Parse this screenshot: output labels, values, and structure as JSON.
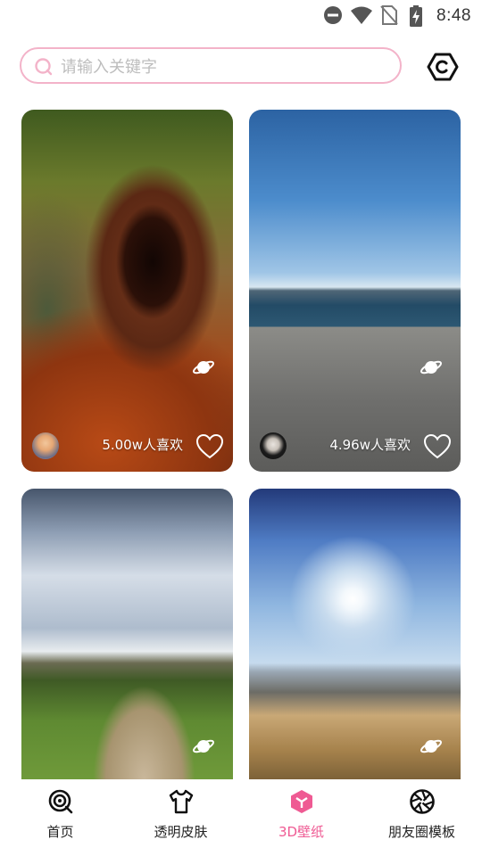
{
  "status_bar": {
    "time": "8:48",
    "icons": [
      "do-not-disturb-icon",
      "wifi-icon",
      "no-sim-icon",
      "battery-charging-icon"
    ]
  },
  "search": {
    "placeholder": "请输入关键字",
    "value": ""
  },
  "header": {
    "settings_icon": "hexagon-settings-icon"
  },
  "wallpapers": [
    {
      "scene": "tunnel",
      "likes_label": "5.00w人喜欢",
      "has_avatar": true
    },
    {
      "scene": "lake-pier",
      "likes_label": "4.96w人喜欢",
      "has_avatar": true
    },
    {
      "scene": "park-path",
      "likes_label": "",
      "has_avatar": false
    },
    {
      "scene": "sunny-pier",
      "likes_label": "",
      "has_avatar": false
    }
  ],
  "nav": {
    "items": [
      {
        "label": "首页",
        "icon": "target-icon"
      },
      {
        "label": "透明皮肤",
        "icon": "tshirt-icon"
      },
      {
        "label": "3D壁纸",
        "icon": "cube-icon",
        "active": true
      },
      {
        "label": "朋友圈模板",
        "icon": "aperture-icon"
      }
    ]
  },
  "colors": {
    "accent": "#ef5a93",
    "search_border": "#f3b3c9"
  }
}
